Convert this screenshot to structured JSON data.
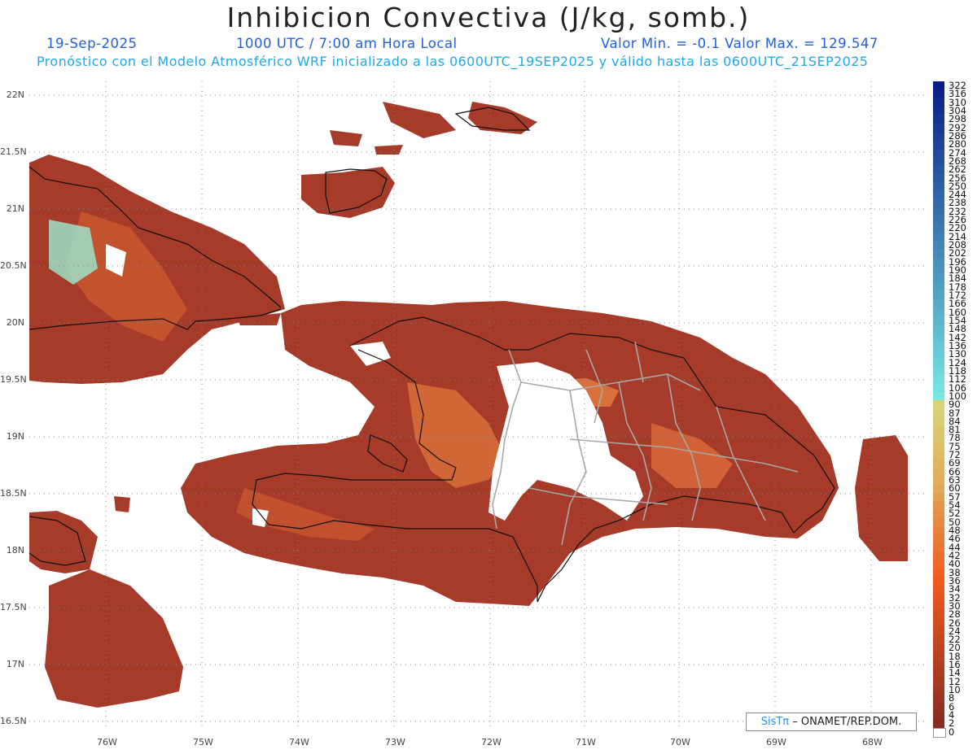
{
  "header": {
    "title": "Inhibicion Convectiva (J/kg, somb.)",
    "date": "19-Sep-2025",
    "time": "1000 UTC / 7:00 am Hora Local",
    "minmax": "Valor Min. = -0.1  Valor Max. = 129.547",
    "model_line": "Pronóstico con el Modelo Atmosférico WRF inicializado a las 0600UTC_19SEP2025 y válido hasta las  0600UTC_21SEP2025"
  },
  "map": {
    "lat_labels": [
      "22N",
      "21.5N",
      "21N",
      "20.5N",
      "20N",
      "19.5N",
      "19N",
      "18.5N",
      "18N",
      "17.5N",
      "17N",
      "16.5N"
    ],
    "lon_labels": [
      "76W",
      "75W",
      "74W",
      "73W",
      "72W",
      "71W",
      "70W",
      "69W",
      "68W"
    ],
    "field_color": "#a53b28",
    "credit_sis": "SisTπ",
    "credit_text": " – ONAMET/REP.DOM."
  },
  "colorbar": {
    "labels": [
      "322",
      "316",
      "310",
      "304",
      "298",
      "292",
      "286",
      "280",
      "274",
      "268",
      "262",
      "256",
      "250",
      "244",
      "238",
      "232",
      "226",
      "220",
      "214",
      "208",
      "202",
      "196",
      "190",
      "184",
      "178",
      "172",
      "166",
      "160",
      "154",
      "148",
      "142",
      "136",
      "130",
      "124",
      "118",
      "112",
      "106",
      "100",
      "90",
      "87",
      "84",
      "81",
      "78",
      "75",
      "72",
      "69",
      "66",
      "63",
      "60",
      "57",
      "54",
      "52",
      "50",
      "48",
      "46",
      "44",
      "42",
      "40",
      "38",
      "36",
      "34",
      "32",
      "30",
      "28",
      "26",
      "24",
      "22",
      "20",
      "18",
      "16",
      "14",
      "12",
      "10",
      "8",
      "6",
      "4",
      "2",
      "0"
    ]
  }
}
